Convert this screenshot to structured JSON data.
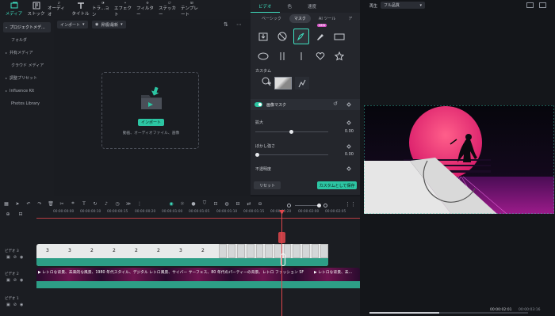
{
  "toolbar": {
    "items": [
      {
        "label": "メディア",
        "icon": "media-icon",
        "active": true
      },
      {
        "label": "ストック",
        "icon": "stock-icon"
      },
      {
        "label": "オーディオ",
        "icon": "audio-icon"
      },
      {
        "label": "タイトル",
        "icon": "title-icon"
      },
      {
        "label": "トラ...ョン",
        "icon": "transition-icon"
      },
      {
        "label": "エフェクト",
        "icon": "effect-icon"
      },
      {
        "label": "フィルター",
        "icon": "filter-icon"
      },
      {
        "label": "ステッカー",
        "icon": "sticker-icon"
      },
      {
        "label": "テンプレート",
        "icon": "template-icon"
      }
    ]
  },
  "sidebar": {
    "items": [
      {
        "label": "プロジェクトメデ...",
        "arrow": "▾",
        "active": true
      },
      {
        "label": "フォルダ",
        "arrow": ""
      },
      {
        "label": "共有メディア",
        "arrow": "▸"
      },
      {
        "label": "クラウド メディア",
        "arrow": ""
      },
      {
        "label": "調整プリセット",
        "arrow": "▸"
      },
      {
        "label": "Influence Kit",
        "arrow": "▸"
      },
      {
        "label": "Photos Library",
        "arrow": ""
      }
    ]
  },
  "media": {
    "import_dropdown": "インポート",
    "sort_dropdown": "昇順/最新",
    "import_button": "インポート",
    "drop_hint": "動画、オーディオファイル、画像"
  },
  "panel": {
    "tabs": [
      "ビデオ",
      "色",
      "速度"
    ],
    "subtabs": [
      "ベーシック",
      "マスク",
      "AI ツール",
      "ア"
    ],
    "new_badge": "NEW",
    "custom_label": "カスタム",
    "image_mask_label": "画像マスク",
    "scale_label": "拡大",
    "scale_value": "0.00",
    "blur_label": "ぼかし強さ",
    "blur_value": "0.00",
    "opacity_label": "不透明度",
    "reset_button": "リセット",
    "save_button": "カスタムとして保存"
  },
  "preview": {
    "title": "再生",
    "quality": "フル品質",
    "time_current": "00:00:02:01",
    "time_total": "00:00:03:16"
  },
  "timeline": {
    "ruler": [
      "00:00:00:00",
      "00:00:00:10",
      "00:00:00:15",
      "00:00:00:20",
      "00:00:01:00",
      "00:00:01:05",
      "00:00:01:10",
      "00:00:01:15",
      "00:00:01:20",
      "00:00:02:00",
      "00:00:02:05",
      "00:00:02:10"
    ],
    "track3_label": "ビデオ 3",
    "track2_label": "ビデオ 2",
    "track1_label": "ビデオ 1",
    "track2_text": "レトロな背景、未来的な風景、1980 年代スタイル、デジタル レトロ風景、サイバー サーフェス、80 年代のパーティーの背景、レトロ ファッション SF",
    "track2_text_b": "レトロな背景、未...",
    "clip_numbers": [
      "3",
      "3",
      "2",
      "2",
      "2",
      "2",
      "3",
      "2",
      "2"
    ]
  },
  "colors": {
    "accent": "#2cc5a3",
    "playhead": "#e0474c",
    "new_badge": "#d856c8"
  }
}
